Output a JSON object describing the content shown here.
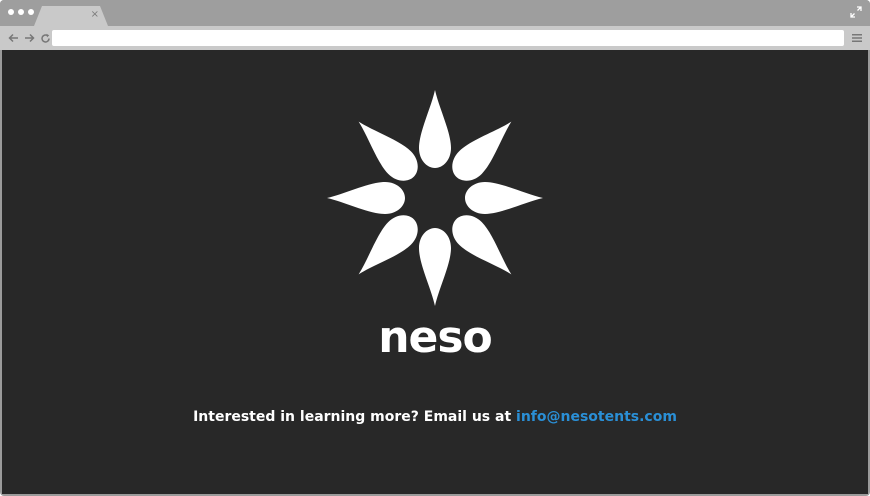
{
  "browser": {
    "tab_close_glyph": "×",
    "address_value": "",
    "icons": [
      "window-dots-icon",
      "close-tab-icon",
      "expand-icon",
      "back-arrow-icon",
      "forward-arrow-icon",
      "reload-icon",
      "menu-icon"
    ]
  },
  "page": {
    "logo_icon": "sunburst-flower-icon",
    "brand_name": "neso",
    "contact_text": "Interested in learning more? Email us at",
    "contact_email": "info@nesotents.com",
    "colors": {
      "background": "#282828",
      "text": "#ffffff",
      "link": "#2a8fd6"
    }
  }
}
